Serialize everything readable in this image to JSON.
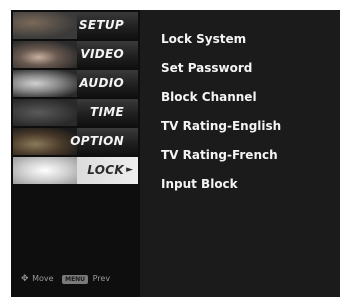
{
  "sidebar": {
    "tabs": [
      {
        "label": "SETUP",
        "active": false
      },
      {
        "label": "VIDEO",
        "active": false
      },
      {
        "label": "AUDIO",
        "active": false
      },
      {
        "label": "TIME",
        "active": false
      },
      {
        "label": "OPTION",
        "active": false
      },
      {
        "label": "LOCK",
        "active": true
      }
    ],
    "hint": {
      "move_label": "Move",
      "prev_key": "MENU",
      "prev_label": "Prev"
    }
  },
  "panel": {
    "items": [
      "Lock System",
      "Set Password",
      "Block Channel",
      "TV Rating-English",
      "TV Rating-French",
      "Input Block"
    ]
  },
  "colors": {
    "background": "#1b1b1b",
    "sidebar": "#0e0e0e",
    "active_tab": "#e0e0e0",
    "text": "#f4f4f4"
  }
}
